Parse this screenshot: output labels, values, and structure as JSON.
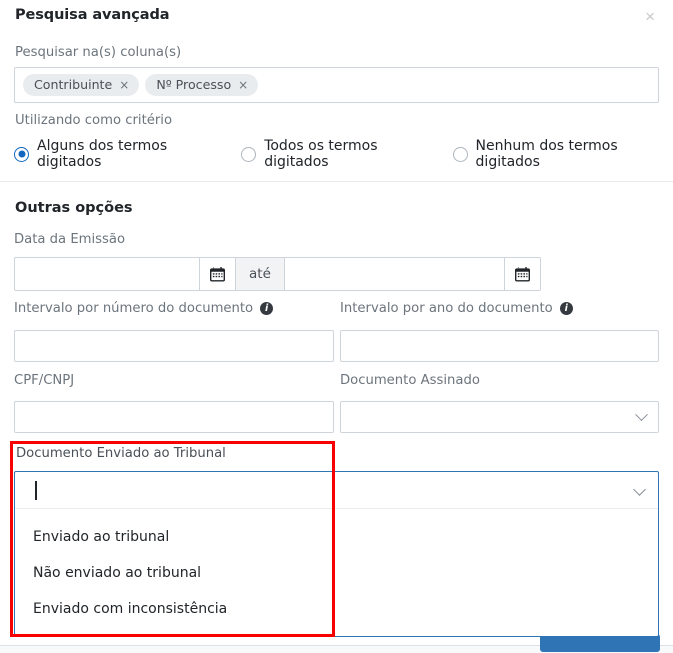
{
  "header": {
    "title": "Pesquisa avançada",
    "close_icon": "close-icon"
  },
  "search_columns": {
    "label": "Pesquisar na(s) coluna(s)",
    "tags": [
      {
        "text": "Contribuinte",
        "remove_icon": "×"
      },
      {
        "text": "Nº Processo",
        "remove_icon": "×"
      }
    ]
  },
  "criteria": {
    "label": "Utilizando como critério",
    "options": [
      {
        "label": "Alguns dos termos digitados",
        "selected": true
      },
      {
        "label": "Todos os termos digitados",
        "selected": false
      },
      {
        "label": "Nenhum dos termos digitados",
        "selected": false
      }
    ]
  },
  "other_options": {
    "section_title": "Outras opções",
    "date_emission": {
      "label": "Data da Emissão",
      "start_value": "",
      "end_value": "",
      "separator_label": "até",
      "calendar_icon": "calendar-icon"
    },
    "interval_number": {
      "label": "Intervalo por número do documento",
      "info_icon": "i",
      "value": ""
    },
    "interval_year": {
      "label": "Intervalo por ano do documento",
      "info_icon": "i",
      "value": ""
    },
    "cpf_cnpj": {
      "label": "CPF/CNPJ",
      "value": ""
    },
    "document_signed": {
      "label": "Documento Assinado",
      "value": ""
    },
    "document_sent_court": {
      "label": "Documento Enviado ao Tribunal",
      "value": "",
      "options": [
        "Enviado ao tribunal",
        "Não enviado ao tribunal",
        "Enviado com inconsistência"
      ]
    }
  },
  "colors": {
    "accent": "#2f75b5",
    "highlight": "#f70000",
    "radio_selected": "#1266bf",
    "label": "#6c757d",
    "border": "#ced4da"
  }
}
